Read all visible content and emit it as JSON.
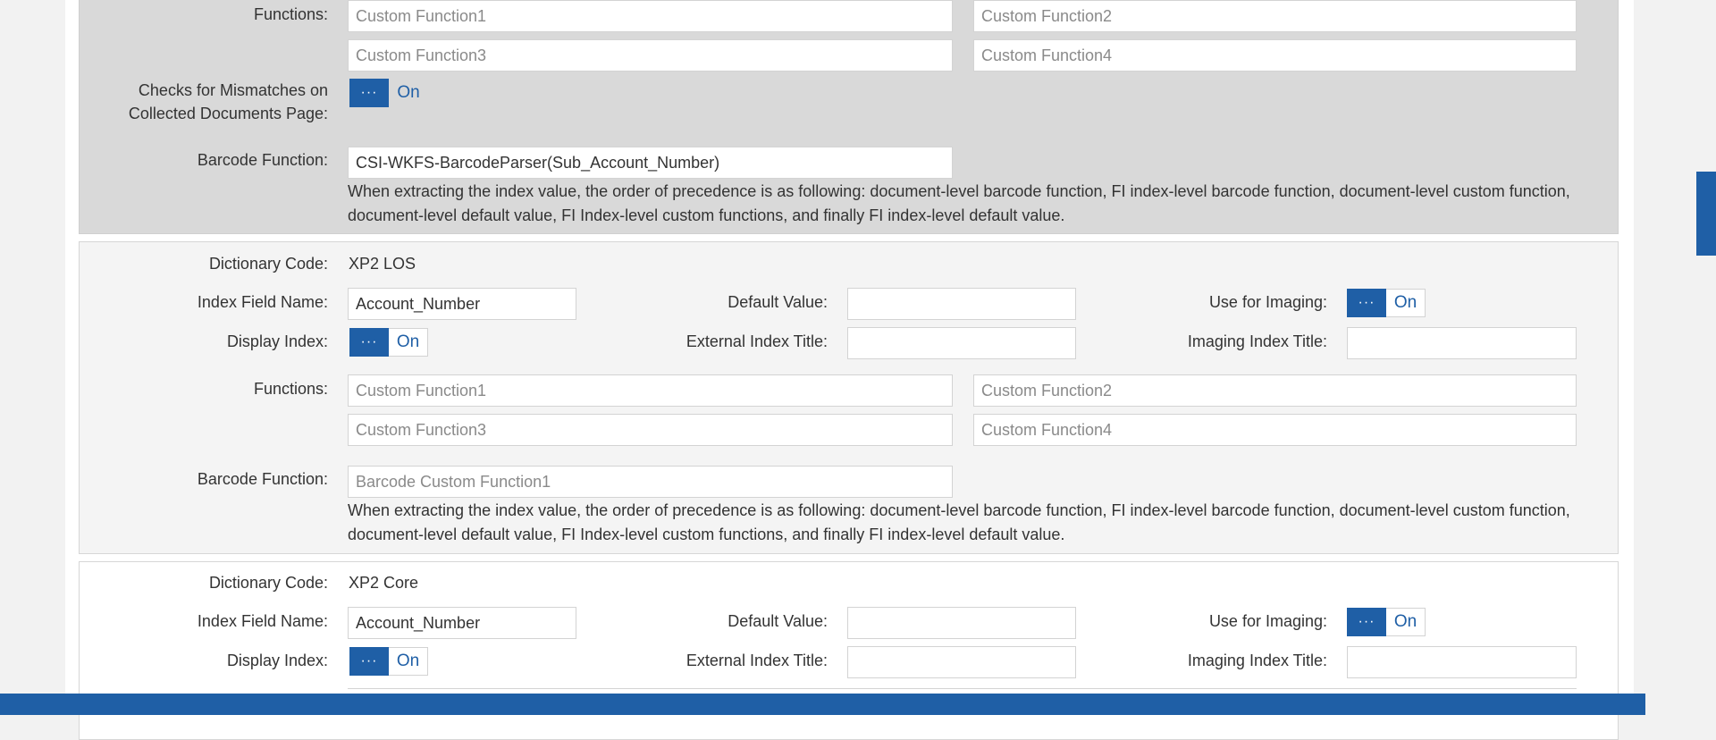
{
  "colors": {
    "accent": "#1f5fa6",
    "grey_section": "#d9d9d9",
    "light_section": "#f4f4f4"
  },
  "toggle": {
    "knob_glyph": "···",
    "state": "On"
  },
  "sections": [
    {
      "functions_label": "Functions:",
      "custom_function_1": "Custom Function1",
      "custom_function_2": "Custom Function2",
      "custom_function_3": "Custom Function3",
      "custom_function_4": "Custom Function4",
      "mismatch_label_line1": "Checks for Mismatches on",
      "mismatch_label_line2": "Collected Documents Page:",
      "barcode_label": "Barcode Function:",
      "barcode_value": "CSI-WKFS-BarcodeParser(Sub_Account_Number)",
      "note_line1": "When extracting the index value, the order of precedence is as following: document-level barcode function, FI index-level barcode function, document-level custom function,",
      "note_line2": "document-level default value, FI Index-level custom functions, and finally FI index-level default value."
    },
    {
      "dictionary_label": "Dictionary Code:",
      "dictionary_value": "XP2 LOS",
      "index_field_label": "Index Field Name:",
      "index_field_value": "Account_Number",
      "default_value_label": "Default Value:",
      "default_value": "",
      "use_imaging_label": "Use for Imaging:",
      "display_index_label": "Display Index:",
      "external_title_label": "External Index Title:",
      "external_title_value": "",
      "imaging_title_label": "Imaging Index Title:",
      "imaging_title_value": "",
      "functions_label": "Functions:",
      "custom_function_1": "Custom Function1",
      "custom_function_2": "Custom Function2",
      "custom_function_3": "Custom Function3",
      "custom_function_4": "Custom Function4",
      "barcode_label": "Barcode Function:",
      "barcode_placeholder": "Barcode Custom Function1",
      "note_line1": "When extracting the index value, the order of precedence is as following: document-level barcode function, FI index-level barcode function, document-level custom function,",
      "note_line2": "document-level default value, FI Index-level custom functions, and finally FI index-level default value."
    },
    {
      "dictionary_label": "Dictionary Code:",
      "dictionary_value": "XP2 Core",
      "index_field_label": "Index Field Name:",
      "index_field_value": "Account_Number",
      "default_value_label": "Default Value:",
      "default_value": "",
      "use_imaging_label": "Use for Imaging:",
      "display_index_label": "Display Index:",
      "external_title_label": "External Index Title:",
      "external_title_value": "",
      "imaging_title_label": "Imaging Index Title:",
      "imaging_title_value": ""
    }
  ]
}
